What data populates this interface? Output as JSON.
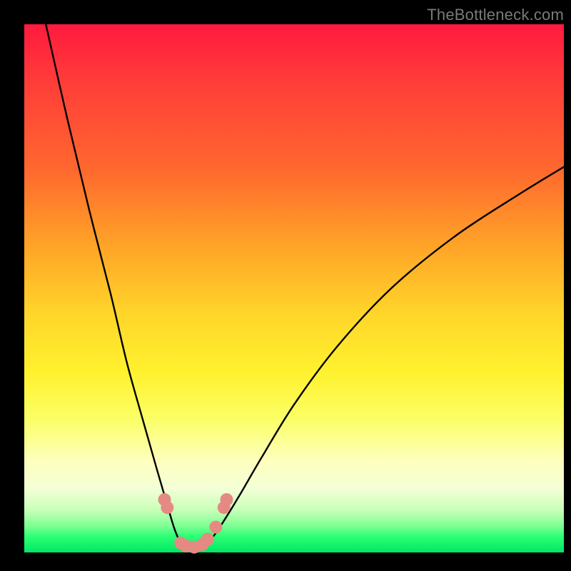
{
  "watermark": "TheBottleneck.com",
  "chart_data": {
    "type": "line",
    "title": "",
    "xlabel": "",
    "ylabel": "",
    "xlim": [
      0,
      100
    ],
    "ylim": [
      0,
      100
    ],
    "grid": false,
    "legend": false,
    "background": "rainbow-gradient-red-to-green",
    "series": [
      {
        "name": "bottleneck-curve",
        "x": [
          4,
          8,
          12,
          16,
          19,
          22,
          24.5,
          26.5,
          28,
          29.5,
          31,
          33,
          35,
          37,
          40,
          44,
          50,
          58,
          68,
          80,
          92,
          100
        ],
        "y": [
          100,
          82,
          65,
          49,
          36,
          25,
          16,
          9,
          4,
          1,
          0.5,
          1,
          3,
          6,
          11,
          18,
          28,
          39,
          50,
          60,
          68,
          73
        ]
      }
    ],
    "markers": [
      {
        "x": 26.0,
        "y": 10.0
      },
      {
        "x": 26.5,
        "y": 8.5
      },
      {
        "x": 29.0,
        "y": 1.8
      },
      {
        "x": 30.0,
        "y": 1.2
      },
      {
        "x": 31.5,
        "y": 1.0
      },
      {
        "x": 33.0,
        "y": 1.5
      },
      {
        "x": 34.0,
        "y": 2.5
      },
      {
        "x": 35.5,
        "y": 4.8
      },
      {
        "x": 37.0,
        "y": 8.5
      },
      {
        "x": 37.5,
        "y": 10.0
      }
    ],
    "marker_radius_px": 9
  }
}
